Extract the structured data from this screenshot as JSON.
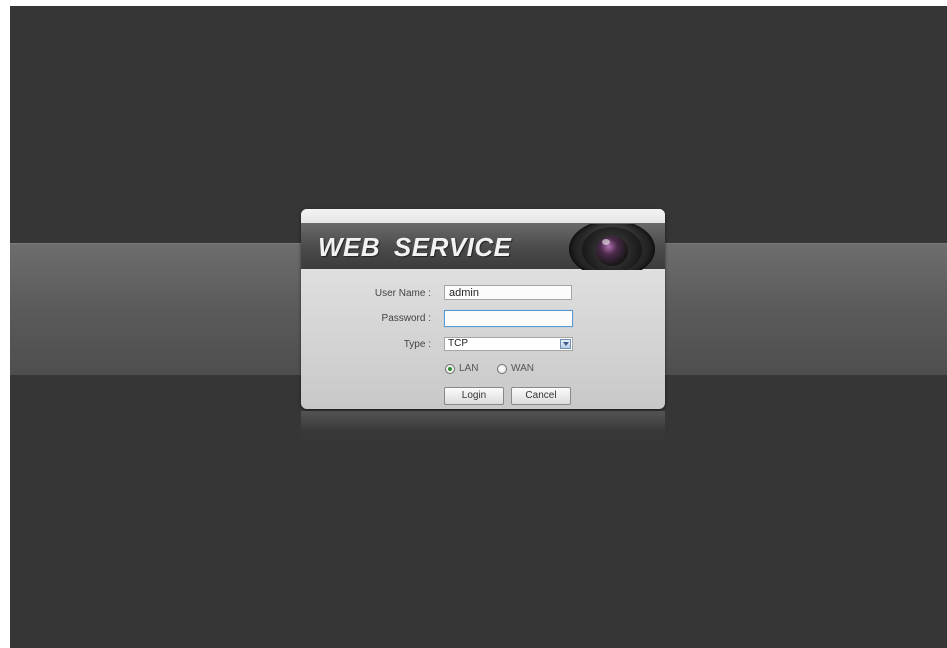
{
  "login": {
    "title": "WEB SERVICE",
    "username_label": "User Name :",
    "username_value": "admin",
    "password_label": "Password :",
    "password_value": "",
    "type_label": "Type :",
    "type_selected": "TCP",
    "network_options": [
      {
        "label": "LAN",
        "selected": true
      },
      {
        "label": "WAN",
        "selected": false
      }
    ],
    "login_button": "Login",
    "cancel_button": "Cancel"
  },
  "icons": {
    "lens": "camera-lens-icon",
    "dropdown": "chevron-down-icon"
  },
  "colors": {
    "background": "#363636",
    "band": "#5c5c5c",
    "panel": "#dcdcdc",
    "header": "#4a4a4a",
    "focus_border": "#5a9bd6",
    "radio_selected": "#2e8a2e"
  }
}
